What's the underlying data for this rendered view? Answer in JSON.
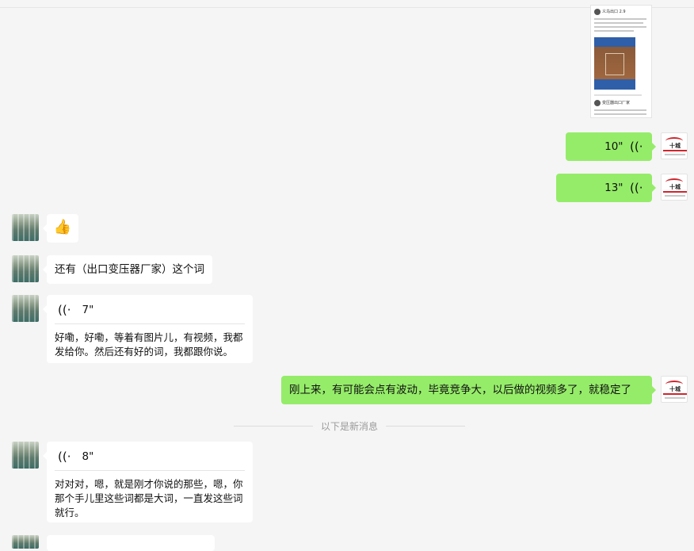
{
  "shared_post": {
    "author": "义乌出口 2.9",
    "company": "变压器出口厂家"
  },
  "messages": {
    "voice_out_1": {
      "duration": "10\""
    },
    "voice_out_2": {
      "duration": "13\""
    },
    "thumbs_up": "👍",
    "text_in_1": "还有（出口变压器厂家）这个词",
    "voice_in_1": {
      "duration": "7\"",
      "transcript": "好嘞，好嘞，等着有图片儿，有视频，我都发给你。然后还有好的词，我都跟你说。"
    },
    "text_out_1": "刚上来，有可能会点有波动，毕竟竞争大，以后做的视频多了，就稳定了",
    "separator": "以下是新消息",
    "voice_in_2": {
      "duration": "8\"",
      "transcript": "对对对，嗯，就是刚才你说的那些，嗯，你那个手儿里这些词都是大词，一直发这些词就行。"
    }
  },
  "icons": {
    "voice_wave": "((·",
    "voice_wave_in": "·))"
  },
  "colors": {
    "outgoing_bubble": "#95ec69",
    "incoming_bubble": "#ffffff",
    "background": "#f5f5f5",
    "logo_red": "#d0262e"
  },
  "avatar_right": {
    "logo_text": "十城"
  }
}
